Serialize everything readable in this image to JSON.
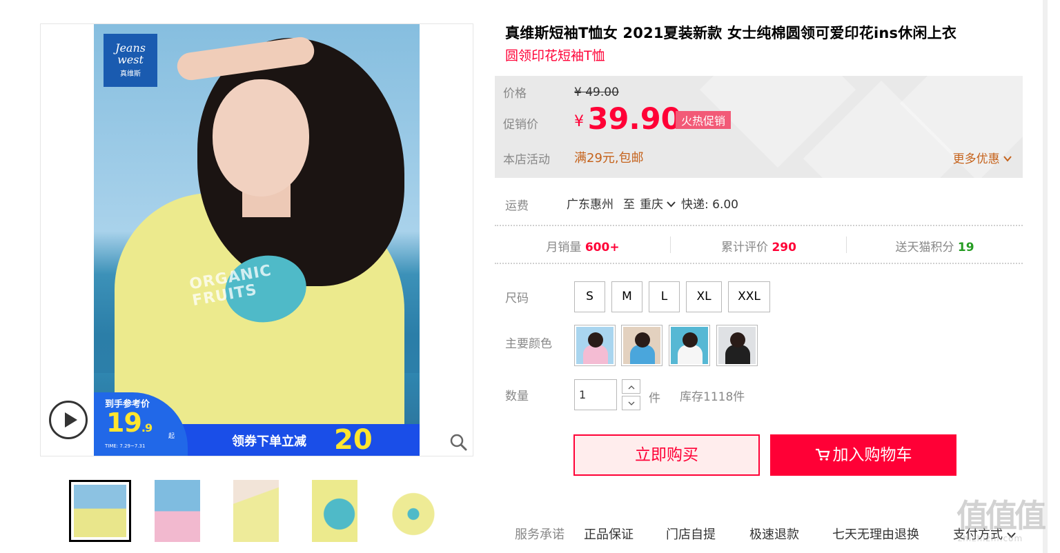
{
  "gallery": {
    "brand_logo_line1": "Jeans",
    "brand_logo_line2": "west",
    "brand_logo_cn": "真维斯",
    "shirt_print_line1": "ORGANIC",
    "shirt_print_line2": "FRUITS",
    "bubble_title": "到手参考价",
    "bubble_price_int": "19",
    "bubble_price_dec": ".9",
    "bubble_qi": "起",
    "bubble_time": "TIME: 7.29~7.31",
    "coupon_text": "领券下单立减",
    "coupon_amount": "20",
    "thumbnails": [
      {
        "desc": "yellow-front",
        "color": "#e9e68b"
      },
      {
        "desc": "pink-model",
        "color": "#f2b9cf"
      },
      {
        "desc": "yellow-neck",
        "color": "#eeeb9a"
      },
      {
        "desc": "yellow-print",
        "color": "#ecea8d"
      },
      {
        "desc": "yellow-flat",
        "color": "#eeeb95"
      }
    ]
  },
  "product": {
    "title": "真维斯短袖T恤女 2021夏装新款 女士纯棉圆领可爱印花ins休闲上衣",
    "subtitle": "圆领印花短袖T恤"
  },
  "price": {
    "label_price": "价格",
    "original": "¥ 49.00",
    "label_promo": "促销价",
    "currency": "¥",
    "promo": "39.90",
    "hot_tag": "火热促销",
    "label_activity": "本店活动",
    "activity": "满29元,包邮",
    "more_offers": "更多优惠"
  },
  "shipping": {
    "label": "运费",
    "from": "广东惠州",
    "to_sep": "至",
    "dest": "重庆",
    "fee": "快递: 6.00"
  },
  "stats": [
    {
      "label": "月销量",
      "value": "600+"
    },
    {
      "label": "累计评价",
      "value": "290"
    },
    {
      "label": "送天猫积分",
      "value": "19"
    }
  ],
  "options": {
    "size_label": "尺码",
    "sizes": [
      "S",
      "M",
      "L",
      "XL",
      "XXL"
    ],
    "color_label": "主要颜色",
    "colors": [
      {
        "name": "pink",
        "hex": "#f4bcd3"
      },
      {
        "name": "blue",
        "hex": "#4aa6dc"
      },
      {
        "name": "white",
        "hex": "#f6f6f6"
      },
      {
        "name": "black",
        "hex": "#202020"
      }
    ],
    "qty_label": "数量",
    "qty_value": "1",
    "qty_unit": "件",
    "stock": "库存1118件"
  },
  "actions": {
    "buy_now": "立即购买",
    "add_to_cart": "加入购物车"
  },
  "service": {
    "label": "服务承诺",
    "items": [
      "正品保证",
      "门店自提",
      "极速退款",
      "七天无理由退换"
    ],
    "payment": "支付方式"
  },
  "watermark": {
    "big": "值值值",
    "small": "zhizhizhi.com"
  },
  "colors": {
    "accent": "#ff0036",
    "activity": "#c5621b",
    "green": "#259c22"
  }
}
